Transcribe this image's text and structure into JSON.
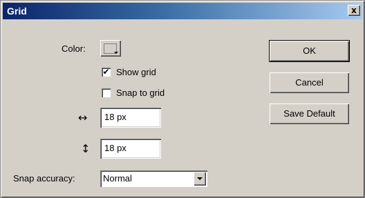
{
  "window": {
    "title": "Grid",
    "close_label": "x"
  },
  "color": {
    "label": "Color:",
    "value": "#d4d0c8"
  },
  "show_grid": {
    "label": "Show grid",
    "checked": true,
    "mark": "✔"
  },
  "snap_to_grid": {
    "label": "Snap to grid",
    "checked": false,
    "mark": ""
  },
  "horizontal_spacing": {
    "icon": "horizontal-arrows-icon",
    "glyph": "↔",
    "value": "18 px"
  },
  "vertical_spacing": {
    "icon": "vertical-arrows-icon",
    "glyph": "↕",
    "value": "18 px"
  },
  "snap_accuracy": {
    "label": "Snap accuracy:",
    "value": "Normal"
  },
  "buttons": {
    "ok": "OK",
    "cancel": "Cancel",
    "save_default": "Save Default"
  }
}
